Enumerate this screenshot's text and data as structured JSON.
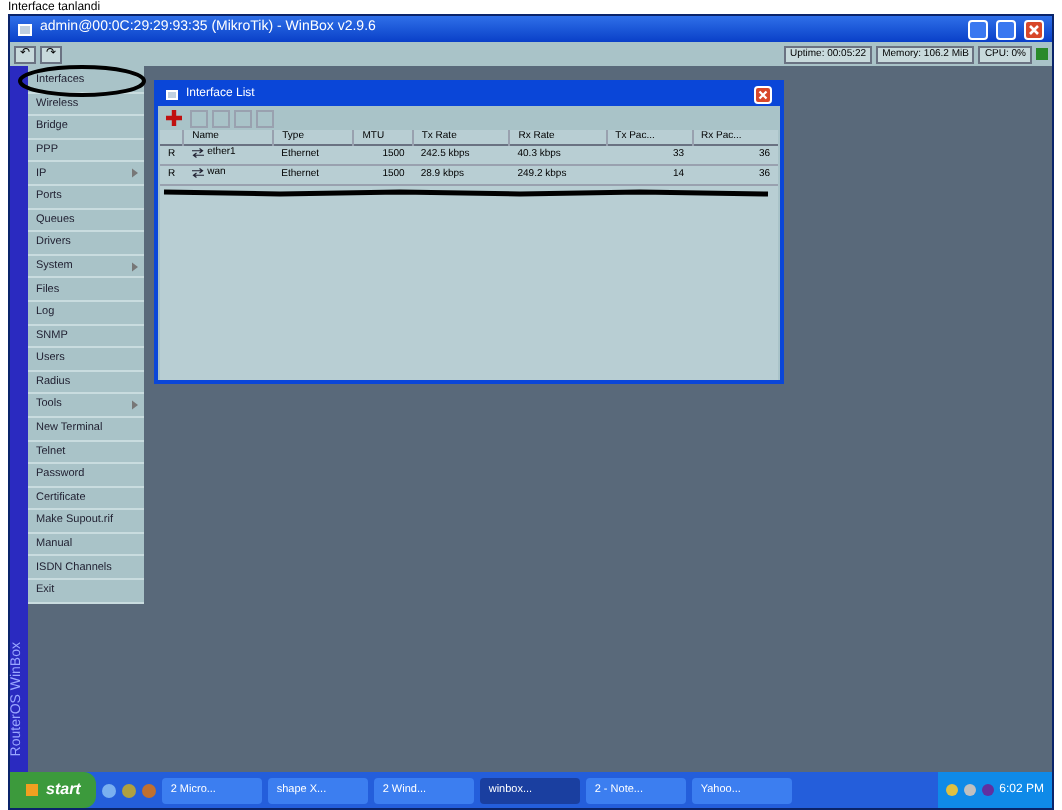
{
  "caption": "Interface tanlandi",
  "window": {
    "title": "admin@00:0C:29:29:93:35 (MikroTik) - WinBox v2.9.6"
  },
  "toolbar": {
    "undo": "↶",
    "redo": "↷",
    "status": [
      "Uptime: 00:05:22",
      "Memory: 106.2 MiB",
      "CPU: 0%"
    ]
  },
  "sidebar": {
    "brand": "RouterOS WinBox",
    "items": [
      {
        "label": "Interfaces",
        "submenu": false,
        "circled": true
      },
      {
        "label": "Wireless",
        "submenu": false,
        "circled": false
      },
      {
        "label": "Bridge",
        "submenu": false,
        "circled": false
      },
      {
        "label": "PPP",
        "submenu": false,
        "circled": false
      },
      {
        "label": "IP",
        "submenu": true,
        "circled": false
      },
      {
        "label": "Ports",
        "submenu": false,
        "circled": false
      },
      {
        "label": "Queues",
        "submenu": false,
        "circled": false
      },
      {
        "label": "Drivers",
        "submenu": false,
        "circled": false
      },
      {
        "label": "System",
        "submenu": true,
        "circled": false
      },
      {
        "label": "Files",
        "submenu": false,
        "circled": false
      },
      {
        "label": "Log",
        "submenu": false,
        "circled": false
      },
      {
        "label": "SNMP",
        "submenu": false,
        "circled": false
      },
      {
        "label": "Users",
        "submenu": false,
        "circled": false
      },
      {
        "label": "Radius",
        "submenu": false,
        "circled": false
      },
      {
        "label": "Tools",
        "submenu": true,
        "circled": false
      },
      {
        "label": "New Terminal",
        "submenu": false,
        "circled": false
      },
      {
        "label": "Telnet",
        "submenu": false,
        "circled": false
      },
      {
        "label": "Password",
        "submenu": false,
        "circled": false
      },
      {
        "label": "Certificate",
        "submenu": false,
        "circled": false
      },
      {
        "label": "Make Supout.rif",
        "submenu": false,
        "circled": false
      },
      {
        "label": "Manual",
        "submenu": false,
        "circled": false
      },
      {
        "label": "ISDN Channels",
        "submenu": false,
        "circled": false
      },
      {
        "label": "Exit",
        "submenu": false,
        "circled": false
      }
    ]
  },
  "interface_list": {
    "title": "Interface List",
    "columns": [
      "Name",
      "Type",
      "MTU",
      "Tx Rate",
      "Rx Rate",
      "Tx Pac...",
      "Rx Pac..."
    ],
    "rows": [
      {
        "flag": "R",
        "name": "ether1",
        "type": "Ethernet",
        "mtu": "1500",
        "tx_rate": "242.5 kbps",
        "rx_rate": "40.3 kbps",
        "tx_packets": "33",
        "rx_packets": "36"
      },
      {
        "flag": "R",
        "name": "wan",
        "type": "Ethernet",
        "mtu": "1500",
        "tx_rate": "28.9 kbps",
        "rx_rate": "249.2 kbps",
        "tx_packets": "14",
        "rx_packets": "36"
      }
    ],
    "scribbled": true
  },
  "taskbar": {
    "start": "start",
    "tasks": [
      {
        "label": "2 Micro...",
        "selected": false
      },
      {
        "label": "shape X...",
        "selected": false
      },
      {
        "label": "2 Wind...",
        "selected": false
      },
      {
        "label": "winbox...",
        "selected": true
      },
      {
        "label": "2 - Note...",
        "selected": false
      },
      {
        "label": "Yahoo...",
        "selected": false
      }
    ],
    "clock": "6:02 PM"
  }
}
